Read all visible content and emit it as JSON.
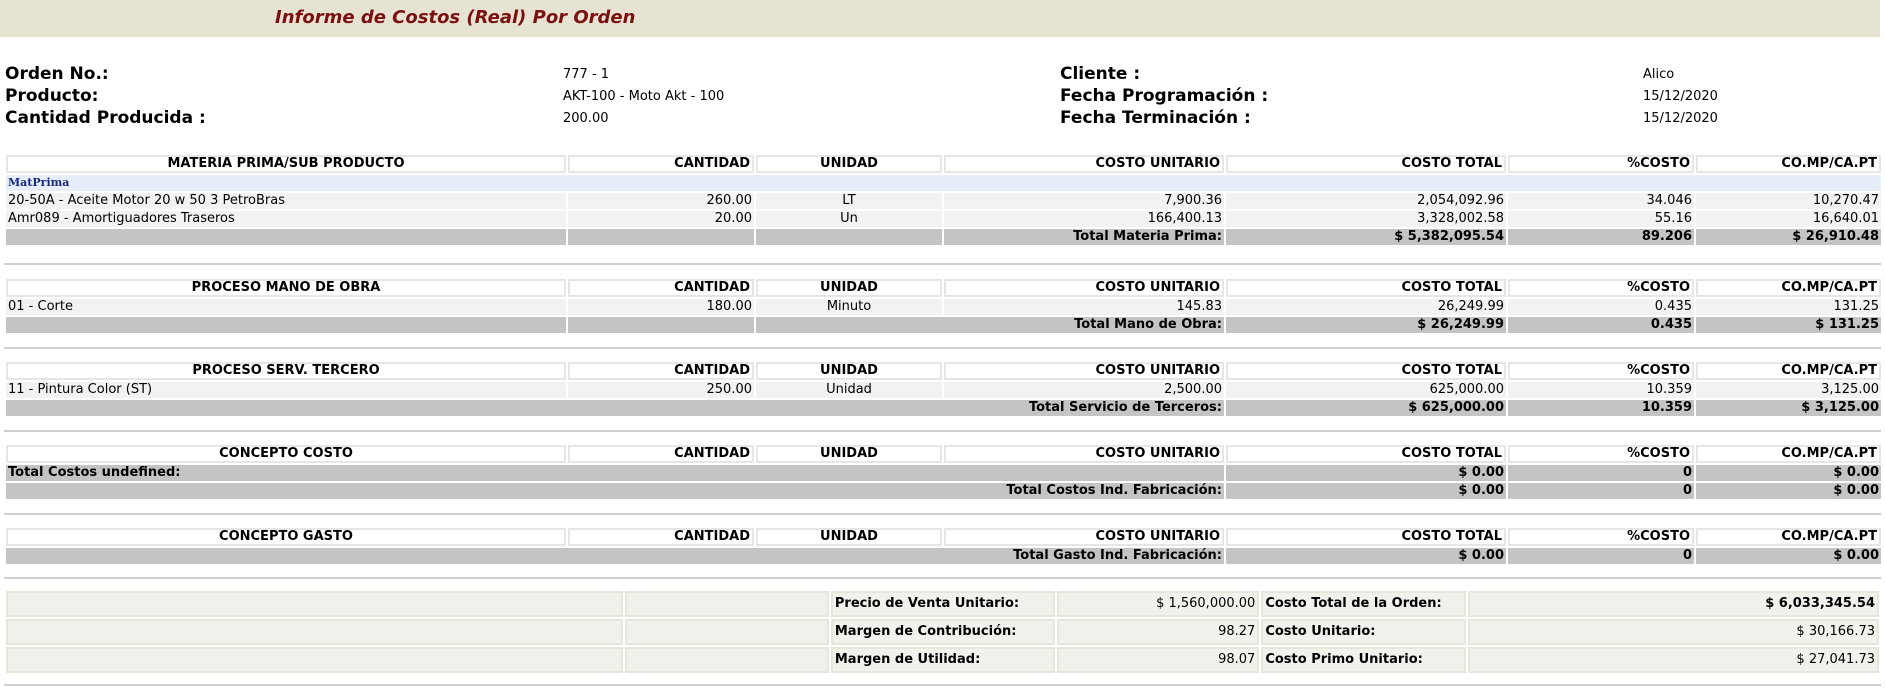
{
  "title": "Informe de Costos (Real) Por Orden",
  "header": {
    "orden_label": "Orden No.:",
    "orden_value": "777 - 1",
    "producto_label": "Producto:",
    "producto_value": "AKT-100 - Moto Akt - 100",
    "cantidad_label": "Cantidad Producida :",
    "cantidad_value": "200.00",
    "cliente_label": "Cliente :",
    "cliente_value": "Alico",
    "fprog_label": "Fecha Programación :",
    "fprog_value": "15/12/2020",
    "fterm_label": "Fecha Terminación :",
    "fterm_value": "15/12/2020"
  },
  "columns": {
    "cantidad": "CANTIDAD",
    "unidad": "UNIDAD",
    "costo_unitario": "COSTO UNITARIO",
    "costo_total": "COSTO TOTAL",
    "pct_costo": "%COSTO",
    "co_mp": "CO.MP/CA.PT"
  },
  "materia": {
    "heading": "MATERIA PRIMA/SUB PRODUCTO",
    "group": "MatPrima",
    "rows": [
      {
        "name": "20-50A - Aceite Motor 20 w 50 3 PetroBras",
        "cantidad": "260.00",
        "unidad": "LT",
        "cu": "7,900.36",
        "ct": "2,054,092.96",
        "pct": "34.046",
        "co": "10,270.47"
      },
      {
        "name": "Amr089 - Amortiguadores Traseros",
        "cantidad": "20.00",
        "unidad": "Un",
        "cu": "166,400.13",
        "ct": "3,328,002.58",
        "pct": "55.16",
        "co": "16,640.01"
      }
    ],
    "total_label": "Total Materia Prima:",
    "total_ct": "$ 5,382,095.54",
    "total_pct": "89.206",
    "total_co": "$ 26,910.48"
  },
  "mano": {
    "heading": "PROCESO MANO DE OBRA",
    "rows": [
      {
        "name": "01 - Corte",
        "cantidad": "180.00",
        "unidad": "Minuto",
        "cu": "145.83",
        "ct": "26,249.99",
        "pct": "0.435",
        "co": "131.25"
      }
    ],
    "total_label": "Total Mano de Obra:",
    "total_ct": "$ 26,249.99",
    "total_pct": "0.435",
    "total_co": "$ 131.25"
  },
  "serv": {
    "heading": "PROCESO SERV. TERCERO",
    "rows": [
      {
        "name": "11 - Pintura Color (ST)",
        "cantidad": "250.00",
        "unidad": "Unidad",
        "cu": "2,500.00",
        "ct": "625,000.00",
        "pct": "10.359",
        "co": "3,125.00"
      }
    ],
    "total_label": "Total Servicio de Terceros:",
    "total_ct": "$ 625,000.00",
    "total_pct": "10.359",
    "total_co": "$ 3,125.00"
  },
  "costo": {
    "heading": "CONCEPTO COSTO",
    "undef_label": "Total Costos undefined:",
    "undef_ct": "$ 0.00",
    "undef_pct": "0",
    "undef_co": "$ 0.00",
    "total_label": "Total Costos Ind. Fabricación:",
    "total_ct": "$ 0.00",
    "total_pct": "0",
    "total_co": "$ 0.00"
  },
  "gasto": {
    "heading": "CONCEPTO GASTO",
    "total_label": "Total Gasto Ind. Fabricación:",
    "total_ct": "$ 0.00",
    "total_pct": "0",
    "total_co": "$ 0.00"
  },
  "summary": {
    "precio_label": "Precio de Venta Unitario:",
    "precio_value": "$ 1,560,000.00",
    "margen_contrib_label": "Margen de Contribución:",
    "margen_contrib_value": "98.27",
    "margen_util_label": "Margen de Utilidad:",
    "margen_util_value": "98.07",
    "costo_orden_label": "Costo Total de la Orden:",
    "costo_orden_value": "$ 6,033,345.54",
    "costo_unit_label": "Costo Unitario:",
    "costo_unit_value": "$ 30,166.73",
    "costo_primo_label": "Costo Primo Unitario:",
    "costo_primo_value": "$ 27,041.73"
  }
}
